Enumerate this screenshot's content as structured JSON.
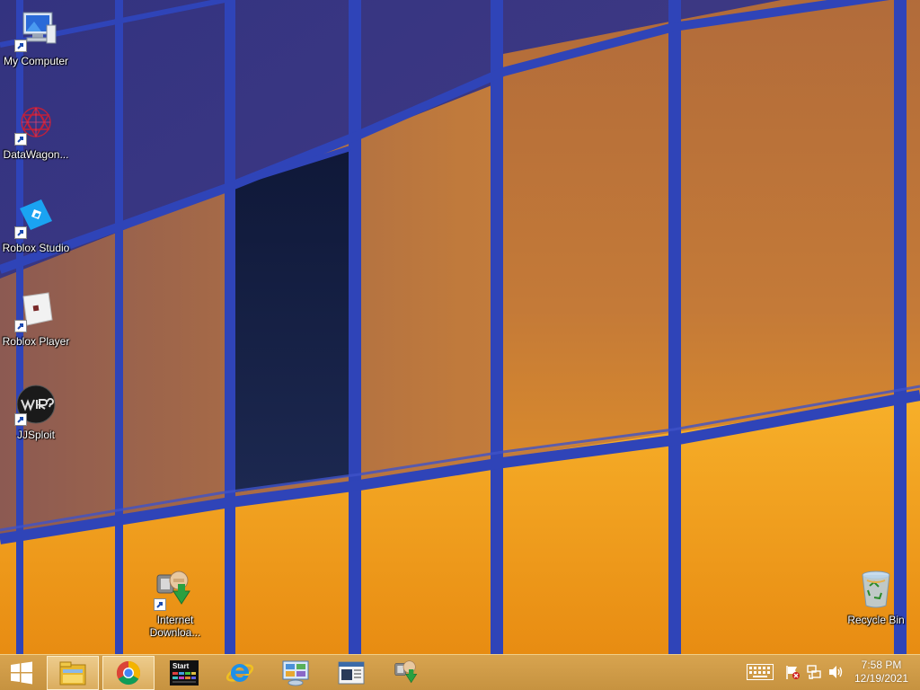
{
  "desktop": {
    "icons": [
      {
        "label": "My Computer",
        "icon": "computer-icon"
      },
      {
        "label": "DataWagon...",
        "icon": "datawagon-icon"
      },
      {
        "label": "Roblox Studio",
        "icon": "roblox-studio-icon"
      },
      {
        "label": "Roblox Player",
        "icon": "roblox-player-icon"
      },
      {
        "label": "JJSploit",
        "icon": "jjsploit-icon"
      },
      {
        "label": "Internet Downloa...",
        "icon": "internet-download-manager-icon"
      },
      {
        "label": "Recycle Bin",
        "icon": "recycle-bin-icon"
      }
    ]
  },
  "taskbar": {
    "start_icon": "windows-logo-icon",
    "pinned": [
      {
        "icon": "file-explorer-icon",
        "active": true
      },
      {
        "icon": "chrome-icon",
        "active": true
      },
      {
        "icon": "start-menu-app-icon",
        "badge": "Start"
      },
      {
        "icon": "internet-explorer-icon"
      },
      {
        "icon": "control-panel-icon"
      },
      {
        "icon": "window-app-icon"
      },
      {
        "icon": "internet-download-manager-icon"
      }
    ],
    "tray": [
      "keyboard-icon",
      "action-center-flag-icon",
      "network-icon",
      "volume-icon"
    ],
    "clock": {
      "time": "7:58 PM",
      "date": "12/19/2021"
    }
  },
  "colors": {
    "frame_blue": "#2f44b8",
    "glass_orange": "#f3a21e",
    "taskbar": "#cf9a4a"
  }
}
